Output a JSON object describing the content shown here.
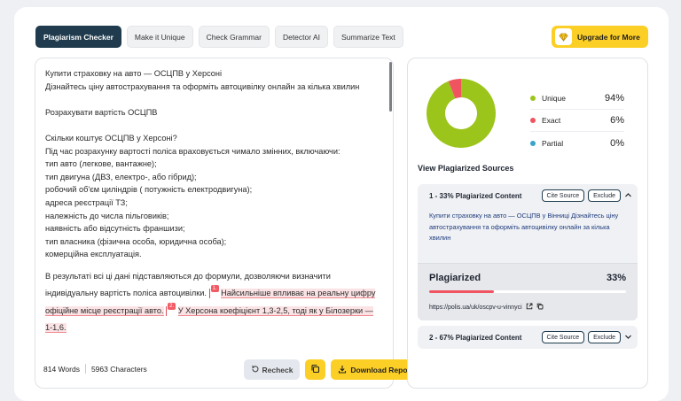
{
  "tabs": [
    {
      "label": "Plagiarism Checker"
    },
    {
      "label": "Make it Unique"
    },
    {
      "label": "Check Grammar"
    },
    {
      "label": "Detector AI"
    },
    {
      "label": "Summarize Text"
    }
  ],
  "upgrade": {
    "label": "Upgrade for More",
    "icon": "diamond-icon"
  },
  "editor": {
    "lines": {
      "l1": "Купити страховку на авто — ОСЦПВ у Херсоні",
      "l2": "Дізнайтесь ціну автострахування та оформіть автоцивілку онлайн за кілька хвилин",
      "l3": "Розрахувати вартість ОСЦПВ",
      "l4": "Скільки коштує ОСЦПВ у Херсоні?",
      "l5": "Під час розрахунку вартості поліса враховується чимало змінних, включаючи:",
      "l6": "тип авто (легкове, вантажне);",
      "l7": "тип двигуна (ДВЗ, електро-, або гібрид);",
      "l8": "робочий об'єм циліндрів ( потужність електродвигуна);",
      "l9": "адреса реєстрації ТЗ;",
      "l10": "належність до числа пільговиків;",
      "l11": "наявність або відсутність франшизи;",
      "l12": "тип власника (фізична особа, юридична особа);",
      "l13": "комерційна експлуатація.",
      "l14": "В результаті всі ці дані підставляються до формули, дозволяючи визначити індивідуальну вартість поліса автоцивілки.",
      "hl1": "Найсильніше впливає на реальну цифру офіційне місце реєстрації авто.",
      "hl2": "У Херсона коефіцієнт 1,3-2,5, тоді як у Білозерки — 1-1,6."
    },
    "badge1": "1.",
    "badge2": "2.",
    "words": "814 Words",
    "characters": "5963 Characters",
    "recheck_label": "Recheck",
    "download_label": "Download Report"
  },
  "results": {
    "legend": [
      {
        "name": "Unique",
        "pct": "94%",
        "color": "#9cc51b"
      },
      {
        "name": "Exact",
        "pct": "6%",
        "color": "#ef5460"
      },
      {
        "name": "Partial",
        "pct": "0%",
        "color": "#3aa3c9"
      }
    ],
    "view_title": "View Plagiarized Sources",
    "source1": {
      "title": "1 - 33% Plagiarized Content",
      "cite": "Cite Source",
      "exclude": "Exclude",
      "text": "Купити страховку на авто — ОСЦПВ у Вінниці Дізнайтесь ціну автострахування та оформіть автоцивілку онлайн за кілька хвилин",
      "plag_label": "Plagiarized",
      "plag_pct": "33%",
      "plag_fraction": 0.33,
      "url": "https://polis.ua/uk/oscpv-u-vinnyci"
    },
    "source2": {
      "title": "2 - 67% Plagiarized Content",
      "cite": "Cite Source",
      "exclude": "Exclude"
    }
  },
  "chart_data": {
    "type": "pie",
    "categories": [
      "Unique",
      "Exact",
      "Partial"
    ],
    "values": [
      94,
      6,
      0
    ],
    "colors": [
      "#9cc51b",
      "#ef5460",
      "#3aa3c9"
    ]
  }
}
